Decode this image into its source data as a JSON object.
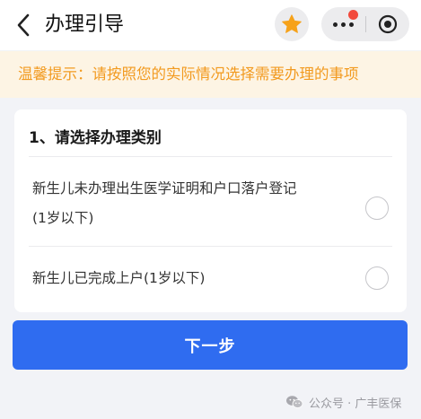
{
  "header": {
    "title": "办理引导"
  },
  "notice": {
    "text": "温馨提示：请按照您的实际情况选择需要办理的事项"
  },
  "form": {
    "section_title": "1、请选择办理类别",
    "options": [
      {
        "line1": "新生儿未办理出生医学证明和户口落户登记",
        "line2": "(1岁以下)",
        "selected": false
      },
      {
        "line1": "新生儿已完成上户(1岁以下)",
        "selected": false
      }
    ]
  },
  "actions": {
    "next_label": "下一步"
  },
  "watermark": {
    "text": "公众号 · 广丰医保"
  },
  "colors": {
    "primary": "#2f6cf0",
    "notice_text": "#f29a1f",
    "notice_bg": "#fdf4e4",
    "star": "#f6a21a",
    "badge": "#f24a3c"
  }
}
